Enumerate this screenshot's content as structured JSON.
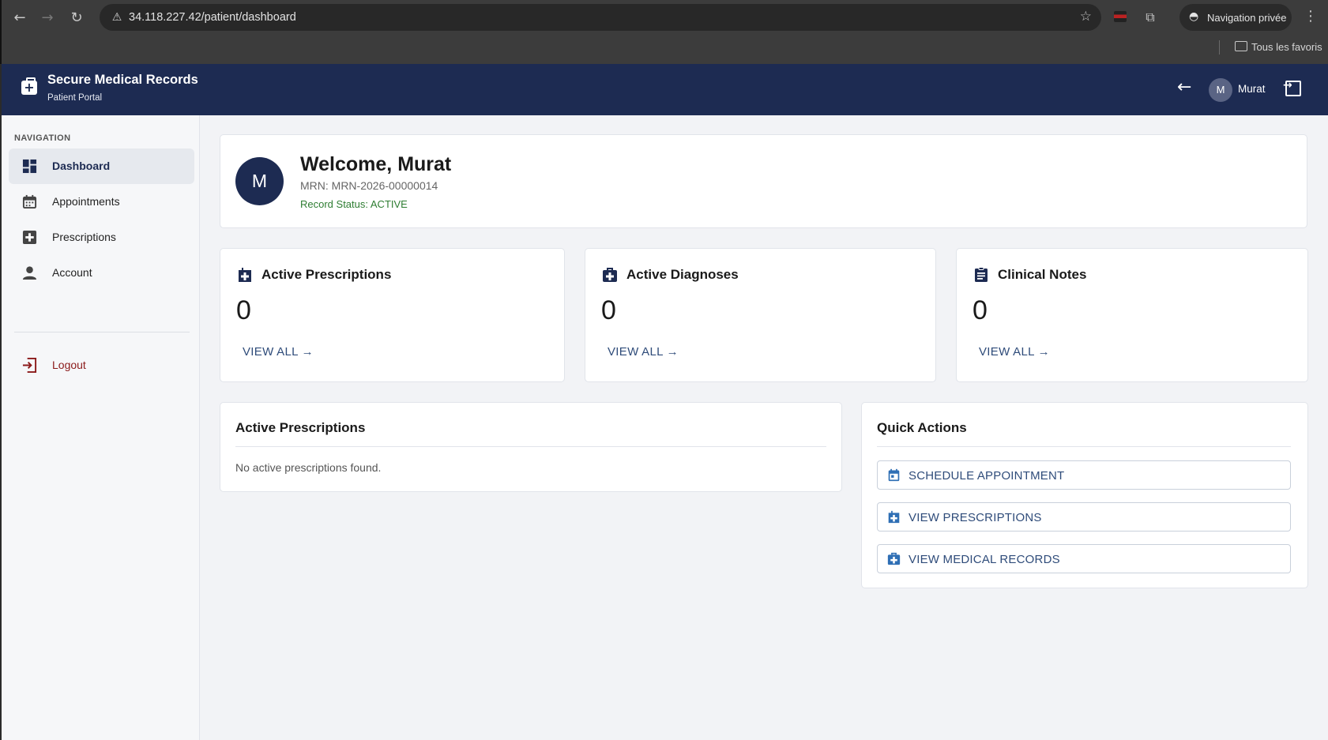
{
  "browser": {
    "url": "34.118.227.42/patient/dashboard",
    "private_label": "Navigation privée",
    "bookmarks_label": "Tous les favoris"
  },
  "header": {
    "title": "Secure Medical Records",
    "subtitle": "Patient Portal",
    "user_initial": "M",
    "user_name": "Murat"
  },
  "sidebar": {
    "heading": "NAVIGATION",
    "items": [
      {
        "label": "Dashboard",
        "icon": "dashboard-icon",
        "active": true
      },
      {
        "label": "Appointments",
        "icon": "calendar-icon"
      },
      {
        "label": "Prescriptions",
        "icon": "medical-plus-icon"
      },
      {
        "label": "Account",
        "icon": "person-icon"
      }
    ],
    "logout_label": "Logout"
  },
  "welcome": {
    "initial": "M",
    "title": "Welcome, Murat",
    "mrn": "MRN: MRN-2026-00000014",
    "status": "Record Status: ACTIVE"
  },
  "stats": [
    {
      "title": "Active Prescriptions",
      "value": "0",
      "link": "VIEW ALL →",
      "icon": "prescription-icon"
    },
    {
      "title": "Active Diagnoses",
      "value": "0",
      "link": "VIEW ALL →",
      "icon": "medical-bag-icon"
    },
    {
      "title": "Clinical Notes",
      "value": "0",
      "link": "VIEW ALL →",
      "icon": "clipboard-icon"
    }
  ],
  "prescriptions_panel": {
    "title": "Active Prescriptions",
    "empty": "No active prescriptions found."
  },
  "quick_actions": {
    "title": "Quick Actions",
    "buttons": [
      {
        "label": "SCHEDULE APPOINTMENT",
        "icon": "calendar-icon"
      },
      {
        "label": "VIEW PRESCRIPTIONS",
        "icon": "prescription-icon"
      },
      {
        "label": "VIEW MEDICAL RECORDS",
        "icon": "medical-bag-icon"
      }
    ]
  },
  "colors": {
    "header_bg": "#1d2b52",
    "accent": "#2f4c7a",
    "status_active": "#2e7d32",
    "logout": "#8b1a1a"
  }
}
